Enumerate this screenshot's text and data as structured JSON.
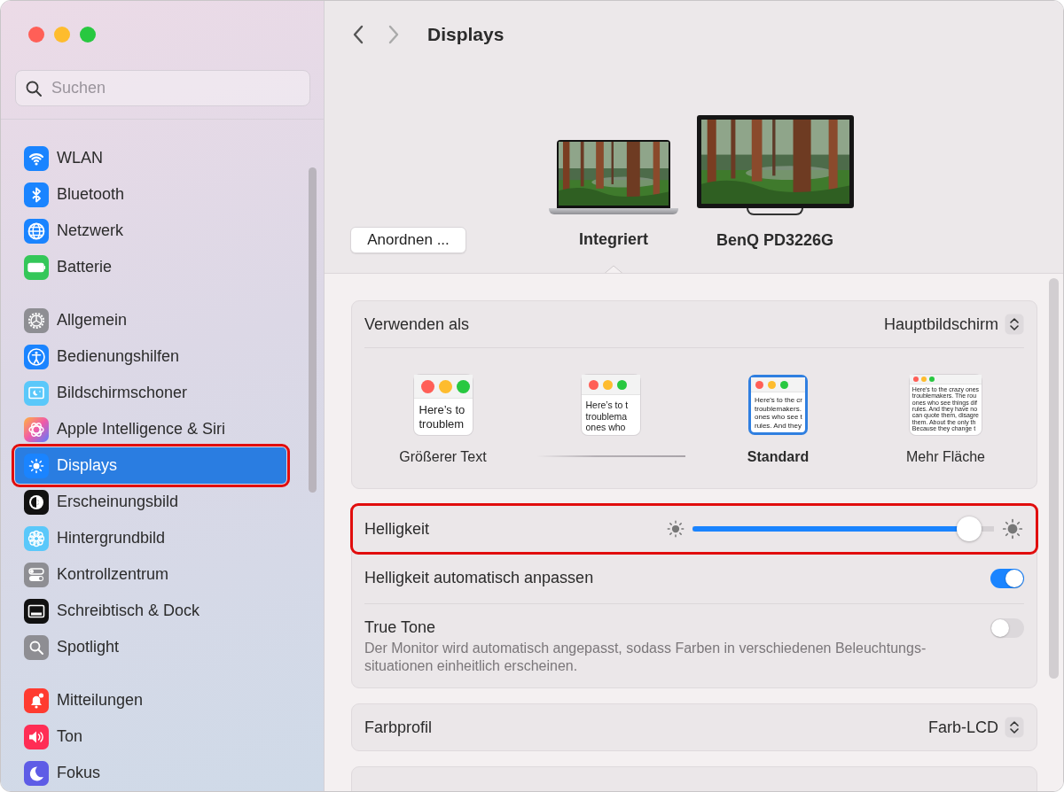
{
  "sidebar": {
    "search": {
      "placeholder": "Suchen"
    },
    "groups": [
      [
        {
          "label": "WLAN",
          "kind": "wlan",
          "selected": false,
          "highlighted": false
        },
        {
          "label": "Bluetooth",
          "kind": "bluetooth",
          "selected": false,
          "highlighted": false
        },
        {
          "label": "Netzwerk",
          "kind": "network",
          "selected": false,
          "highlighted": false
        },
        {
          "label": "Batterie",
          "kind": "battery",
          "selected": false,
          "highlighted": false
        }
      ],
      [
        {
          "label": "Allgemein",
          "kind": "general",
          "selected": false,
          "highlighted": false
        },
        {
          "label": "Bedienungshilfen",
          "kind": "accessibility",
          "selected": false,
          "highlighted": false
        },
        {
          "label": "Bildschirmschoner",
          "kind": "screensaver",
          "selected": false,
          "highlighted": false
        },
        {
          "label": "Apple Intelligence & Siri",
          "kind": "siri",
          "selected": false,
          "highlighted": false
        },
        {
          "label": "Displays",
          "kind": "displays",
          "selected": true,
          "highlighted": true
        },
        {
          "label": "Erscheinungsbild",
          "kind": "appearance",
          "selected": false,
          "highlighted": false
        },
        {
          "label": "Hintergrundbild",
          "kind": "wallpaper",
          "selected": false,
          "highlighted": false
        },
        {
          "label": "Kontrollzentrum",
          "kind": "control",
          "selected": false,
          "highlighted": false
        },
        {
          "label": "Schreibtisch & Dock",
          "kind": "dock",
          "selected": false,
          "highlighted": false
        },
        {
          "label": "Spotlight",
          "kind": "spotlight",
          "selected": false,
          "highlighted": false
        }
      ],
      [
        {
          "label": "Mitteilungen",
          "kind": "notifications",
          "selected": false,
          "highlighted": false
        },
        {
          "label": "Ton",
          "kind": "sound",
          "selected": false,
          "highlighted": false
        },
        {
          "label": "Fokus",
          "kind": "focus",
          "selected": false,
          "highlighted": false
        }
      ]
    ]
  },
  "toolbar": {
    "title": "Displays"
  },
  "displays": {
    "arrange_button": "Anordnen ...",
    "items": [
      {
        "label": "Integriert",
        "kind": "laptop",
        "selected": true
      },
      {
        "label": "BenQ PD3226G",
        "kind": "monitor",
        "selected": false
      }
    ]
  },
  "use_as": {
    "label": "Verwenden als",
    "value": "Hauptbildschirm"
  },
  "resolutions": [
    {
      "label": "Größerer Text",
      "kind": "larger",
      "selected": false,
      "preview": [
        "Here’s to",
        "troublem"
      ]
    },
    {
      "kind": "large",
      "selected": false,
      "preview": [
        "Here’s to t",
        "troublema",
        "ones who"
      ]
    },
    {
      "label": "Standard",
      "kind": "standard",
      "selected": true,
      "preview": [
        "Here's to the cr",
        "troublemakers.",
        "ones who see t",
        "rules. And they"
      ]
    },
    {
      "label": "Mehr Fläche",
      "kind": "more",
      "selected": false,
      "preview": [
        "Here's to the crazy ones",
        "troublemakers. The rou",
        "ones who see things dif",
        "rules. And they have no",
        "can quote them, disagre",
        "them. About the only th",
        "Because they change t"
      ]
    }
  ],
  "brightness": {
    "label": "Helligkeit",
    "level": 0.96,
    "highlighted": true
  },
  "auto_brightness": {
    "label": "Helligkeit automatisch anpassen",
    "on": true
  },
  "true_tone": {
    "label": "True Tone",
    "description": "Der Monitor wird automatisch angepasst, sodass Farben in verschiedenen Beleuchtungs-situationen einheitlich erscheinen.",
    "on": false
  },
  "color_profile": {
    "label": "Farbprofil",
    "value": "Farb-LCD"
  }
}
